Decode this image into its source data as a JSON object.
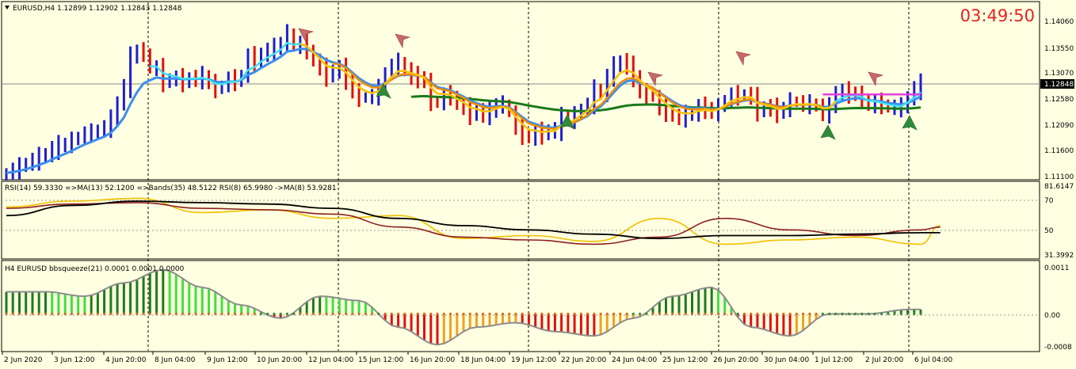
{
  "main": {
    "header": "EURUSD,H4  1.12899 1.12902 1.12843 1.12848",
    "clock": "03:49:50",
    "price_ticks": [
      "1.14060",
      "1.13550",
      "1.13070",
      "1.12580",
      "1.12090",
      "1.11600",
      "1.11100"
    ],
    "current_price_label": "1.12848",
    "ylim": [
      1.11,
      1.1445
    ]
  },
  "rsi": {
    "header": "RSI(14) 59.3330  =>MA(13) 52.1200  =>Bands(35) 48.5122  RSI(8) 65.9980  ->MA(8) 53.9281",
    "ticks": [
      "81.6147",
      "70",
      "50",
      "31.3992"
    ],
    "ylim": [
      31.3992,
      81.6147
    ]
  },
  "bbsqueeze": {
    "header": "H4 EURUSD bbsqueeze(21) 0.0001 0.0001 0.0000",
    "ticks": [
      "0.0011",
      "0.00",
      "-0.0008"
    ],
    "ylim": [
      -0.0008,
      0.0011
    ]
  },
  "x_ticks": [
    "2 Jun 2020",
    "3 Jun 12:00",
    "4 Jun 20:00",
    "8 Jun 04:00",
    "9 Jun 12:00",
    "10 Jun 20:00",
    "12 Jun 04:00",
    "15 Jun 12:00",
    "16 Jun 20:00",
    "18 Jun 04:00",
    "19 Jun 12:00",
    "22 Jun 20:00",
    "24 Jun 04:00",
    "25 Jun 12:00",
    "26 Jun 20:00",
    "30 Jun 04:00",
    "1 Jul 12:00",
    "2 Jul 20:00",
    "6 Jul 04:00"
  ],
  "colors": {
    "background": "#ffffe1",
    "up_bar": "#1f1fd0",
    "down_bar": "#e01010",
    "ma_cyan": "#40e0f0",
    "ma_blue": "#3a8ff0",
    "ma_orange": "#f08c00",
    "ma_gold": "#ffc000",
    "ma_green": "#1a7a1a",
    "ma_magenta": "#e040e0",
    "rsi_black": "#000000",
    "rsi_brown": "#8b2020",
    "rsi_gold": "#f0c000",
    "hist_dark_green": "#1e7a1e",
    "hist_light_green": "#40e040",
    "hist_red": "#e01010",
    "hist_orange": "#f0a020",
    "clock": "#e52222"
  },
  "chart_data": [
    {
      "type": "bar",
      "title": "EURUSD,H4",
      "series": [
        {
          "name": "close",
          "values": [
            1.1112,
            1.1118,
            1.1124,
            1.1131,
            1.1136,
            1.1143,
            1.1149,
            1.1158,
            1.1165,
            1.1168,
            1.1175,
            1.1183,
            1.1189,
            1.119,
            1.1196,
            1.12,
            1.1216,
            1.125,
            1.1279,
            1.1338,
            1.135,
            1.1346,
            1.1315,
            1.1318,
            1.1288,
            1.1296,
            1.1297,
            1.1289,
            1.1297,
            1.1296,
            1.13,
            1.1288,
            1.1275,
            1.1283,
            1.1296,
            1.129,
            1.1303,
            1.134,
            1.1327,
            1.1345,
            1.135,
            1.1355,
            1.1365,
            1.1385,
            1.1358,
            1.1366,
            1.1352,
            1.133,
            1.1317,
            1.13,
            1.1312,
            1.1316,
            1.1295,
            1.127,
            1.1258,
            1.126,
            1.1262,
            1.1277,
            1.1308,
            1.132,
            1.1327,
            1.1312,
            1.13,
            1.1298,
            1.129,
            1.125,
            1.1248,
            1.1265,
            1.1262,
            1.1245,
            1.124,
            1.1225,
            1.1232,
            1.1226,
            1.1232,
            1.1245,
            1.1246,
            1.123,
            1.12,
            1.1185,
            1.118,
            1.1192,
            1.1187,
            1.1195,
            1.1195,
            1.122,
            1.1215,
            1.1225,
            1.1238,
            1.1245,
            1.1276,
            1.1265,
            1.13,
            1.132,
            1.133,
            1.132,
            1.13,
            1.127,
            1.1265,
            1.126,
            1.1238,
            1.123,
            1.1222,
            1.122,
            1.1225,
            1.1228,
            1.124,
            1.1238,
            1.123,
            1.124,
            1.1255,
            1.1265,
            1.1262,
            1.1265,
            1.126,
            1.1232,
            1.124,
            1.1238,
            1.123,
            1.1238,
            1.1252,
            1.125,
            1.1245,
            1.1247,
            1.1242,
            1.1228,
            1.124,
            1.127,
            1.127,
            1.1268,
            1.1265,
            1.1255,
            1.1242,
            1.125,
            1.1245,
            1.124,
            1.124,
            1.124,
            1.126,
            1.1275,
            1.1285
          ]
        }
      ],
      "ylim": [
        1.11,
        1.1445
      ]
    },
    {
      "type": "line",
      "title": "RSI(14) 59.3330  =>MA(13) 52.1200  =>Bands(35) 48.5122  RSI(8) 65.9980  ->MA(8) 53.9281",
      "x": [
        0,
        10,
        20,
        30,
        40,
        50,
        60,
        70,
        80,
        90,
        100,
        110,
        120,
        130,
        140,
        143
      ],
      "series": [
        {
          "name": "RSI(8)",
          "values": [
            66,
            70,
            72,
            62,
            64,
            58,
            60,
            44,
            46,
            42,
            58,
            40,
            43,
            45,
            40,
            53
          ]
        },
        {
          "name": "RSI(14)",
          "values": [
            65,
            68,
            69,
            65,
            64,
            61,
            52,
            45,
            43,
            40,
            45,
            58,
            50,
            46,
            50,
            52
          ]
        },
        {
          "name": "MA",
          "values": [
            60,
            67,
            70,
            69,
            68,
            65,
            58,
            53,
            50,
            47,
            44,
            46,
            46,
            47,
            48,
            48
          ]
        }
      ],
      "ylim": [
        31.3992,
        81.6147
      ]
    },
    {
      "type": "bar",
      "title": "H4 EURUSD bbsqueeze(21) 0.0001 0.0001 0.0000",
      "x": [
        0,
        6,
        12,
        18,
        24,
        30,
        36,
        42,
        48,
        54,
        60,
        66,
        72,
        78,
        84,
        90,
        96,
        102,
        108,
        114,
        120,
        126,
        132,
        138,
        143
      ],
      "series": [
        {
          "name": "bbsqueeze",
          "values": [
            0.0005,
            0.0005,
            0.0004,
            0.0007,
            0.001,
            0.0006,
            0.0002,
            -0.0001,
            0.0004,
            0.0003,
            -0.0003,
            -0.0007,
            -0.0003,
            -0.0002,
            -0.0004,
            -0.0005,
            -0.0001,
            0.0004,
            0.0006,
            -0.0003,
            -0.0005,
            0.0,
            0.0,
            0.0001,
            0.0001
          ]
        }
      ],
      "ylim": [
        -0.0008,
        0.0011
      ]
    }
  ]
}
